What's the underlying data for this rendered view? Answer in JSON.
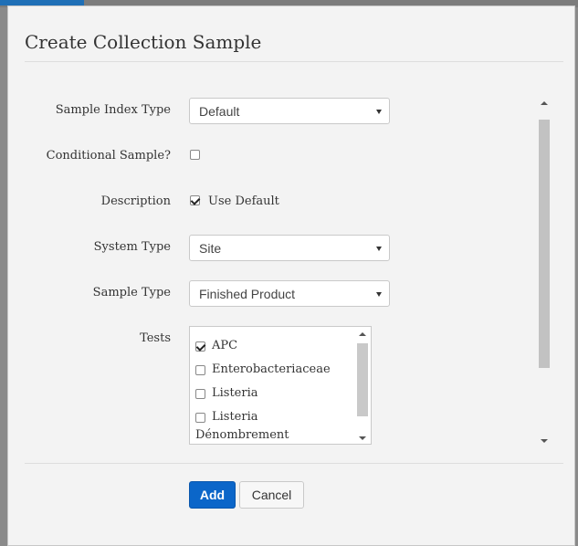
{
  "modal": {
    "title": "Create Collection Sample",
    "fields": {
      "sample_index_type": {
        "label": "Sample Index Type",
        "value": "Default"
      },
      "conditional_sample": {
        "label": "Conditional Sample?",
        "checked": false
      },
      "description": {
        "label": "Description",
        "checkbox_label": "Use Default",
        "checked": true
      },
      "system_type": {
        "label": "System Type",
        "value": "Site"
      },
      "sample_type": {
        "label": "Sample Type",
        "value": "Finished Product"
      },
      "tests": {
        "label": "Tests",
        "items": [
          {
            "label": "APC",
            "checked": true
          },
          {
            "label": "Enterobacteriaceae",
            "checked": false
          },
          {
            "label": "Listeria",
            "checked": false
          },
          {
            "label": "Listeria",
            "label_line2": "Dénombrement",
            "checked": false
          }
        ]
      }
    },
    "buttons": {
      "add": "Add",
      "cancel": "Cancel"
    }
  }
}
